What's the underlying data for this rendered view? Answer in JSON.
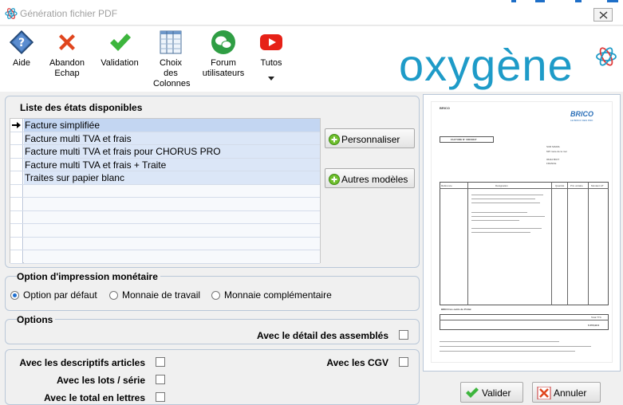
{
  "window": {
    "title": "Génération fichier PDF"
  },
  "toolbar": {
    "aide": "Aide",
    "abandon": "Abandon\nEchap",
    "validation": "Validation",
    "colonnes": "Choix\ndes\nColonnes",
    "forum": "Forum\nutilisateurs",
    "tutos": "Tutos"
  },
  "brand": {
    "logo_text": "oxygène",
    "accent": "#1e9bc8"
  },
  "states": {
    "title": "Liste des états disponibles",
    "items": [
      "Facture simplifiée",
      "Facture multi TVA et frais",
      "Facture multi TVA et frais pour CHORUS PRO",
      "Facture multi TVA et frais + Traite",
      "Traites sur papier blanc"
    ],
    "selected_index": 0,
    "personnaliser": "Personnaliser",
    "autres_modeles": "Autres modèles"
  },
  "monetary": {
    "title": "Option d'impression monétaire",
    "options": [
      "Option par défaut",
      "Monnaie de travail",
      "Monnaie complémentaire"
    ],
    "selected_index": 0
  },
  "options": {
    "title": "Options",
    "detail_assembles": "Avec le détail des assemblés",
    "descriptifs": "Avec les descriptifs articles",
    "lots_serie": "Avec les lots / série",
    "total_lettres": "Avec le total en lettres",
    "cgv": "Avec les CGV"
  },
  "preview": {
    "company": "BRICO",
    "logo": "BRICO",
    "logo_sub": "LE BRICO DES PRO",
    "invoice_title": "FACTURE N° 00000227",
    "client_name": "SUR MARIA",
    "client_address": "625 route de la mer",
    "client_city": "06410 BIOT",
    "client_country": "FRANCE",
    "col_ref": "Référence",
    "col_designation": "Désignation",
    "col_qty": "Quantité",
    "col_unit": "Prix unitaire",
    "col_amount": "Montant HT",
    "footer_tag": "BRICO les outils du Pt Bat",
    "total_label": "Total TTC",
    "total_value": "6 255,99 €"
  },
  "actions": {
    "valider": "Valider",
    "annuler": "Annuler"
  }
}
